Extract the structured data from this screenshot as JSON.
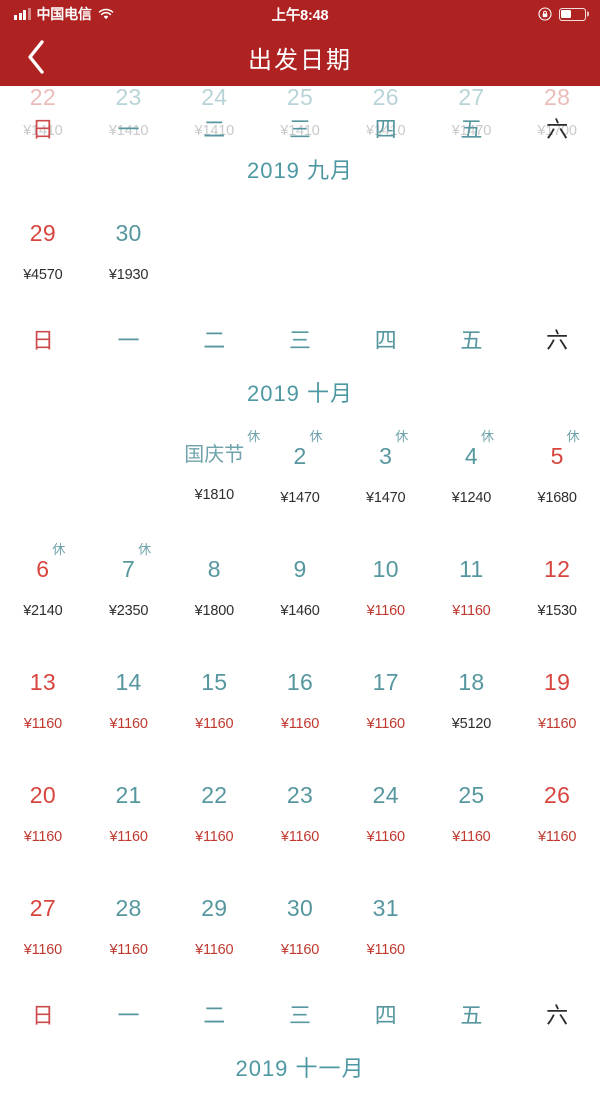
{
  "status_bar": {
    "carrier": "中国电信",
    "time": "上午8:48",
    "signal_icon": "signal-bars-icon",
    "wifi_icon": "wifi-icon",
    "rotation_lock_icon": "rotation-lock-icon",
    "battery_icon": "battery-icon",
    "battery_level_pct": 45,
    "background_color": "#AF2222"
  },
  "nav_bar": {
    "back_icon": "chevron-left-icon",
    "title": "出发日期",
    "background_color": "#AF2222"
  },
  "theme": {
    "accent_red": "#AF2222",
    "teal": "#56979F",
    "month_teal": "#4E98A3",
    "weekend_red": "#D8453E",
    "price_red": "#C0392F",
    "price_dark": "#2E2E2E",
    "faded_teal": "#B9D4D8",
    "faded_red": "#EBBCBA",
    "faded_gray": "#C9C9C9"
  },
  "weekday_header": {
    "labels": [
      "日",
      "一",
      "二",
      "三",
      "四",
      "五",
      "六"
    ],
    "sunday_color": "#CC4B4B",
    "saturday_color": "#2B2B2B",
    "weekday_color": "#56979F"
  },
  "currency_symbol": "¥",
  "rest_badge_label": "休",
  "months": [
    {
      "id": "september",
      "title": "2019  九月",
      "year": "2019",
      "month_label": "九月",
      "clipped_top_row": {
        "days": [
          {
            "num": "22",
            "price": "¥1410",
            "weekend": true
          },
          {
            "num": "23",
            "price": "¥1410",
            "weekend": false
          },
          {
            "num": "24",
            "price": "¥1410",
            "weekend": false
          },
          {
            "num": "25",
            "price": "¥1410",
            "weekend": false
          },
          {
            "num": "26",
            "price": "¥1410",
            "weekend": false
          },
          {
            "num": "27",
            "price": "¥1470",
            "weekend": false
          },
          {
            "num": "28",
            "price": "¥1700",
            "weekend": true
          }
        ]
      },
      "weeks": [
        [
          {
            "num": "29",
            "price": "¥4570",
            "weekend": true,
            "price_low": false,
            "rest": false
          },
          {
            "num": "30",
            "price": "¥1930",
            "weekend": false,
            "price_low": false,
            "rest": false
          },
          {
            "blank": true
          },
          {
            "blank": true
          },
          {
            "blank": true
          },
          {
            "blank": true
          },
          {
            "blank": true
          }
        ]
      ]
    },
    {
      "id": "october",
      "title": "2019  十月",
      "year": "2019",
      "month_label": "十月",
      "weeks": [
        [
          {
            "blank": true
          },
          {
            "blank": true
          },
          {
            "num": "国庆节",
            "festival": true,
            "price": "¥1810",
            "weekend": false,
            "price_low": false,
            "rest": true
          },
          {
            "num": "2",
            "price": "¥1470",
            "weekend": false,
            "price_low": false,
            "rest": true
          },
          {
            "num": "3",
            "price": "¥1470",
            "weekend": false,
            "price_low": false,
            "rest": true
          },
          {
            "num": "4",
            "price": "¥1240",
            "weekend": false,
            "price_low": false,
            "rest": true
          },
          {
            "num": "5",
            "price": "¥1680",
            "weekend": true,
            "price_low": false,
            "rest": true
          }
        ],
        [
          {
            "num": "6",
            "price": "¥2140",
            "weekend": true,
            "price_low": false,
            "rest": true
          },
          {
            "num": "7",
            "price": "¥2350",
            "weekend": false,
            "price_low": false,
            "rest": true
          },
          {
            "num": "8",
            "price": "¥1800",
            "weekend": false,
            "price_low": false,
            "rest": false
          },
          {
            "num": "9",
            "price": "¥1460",
            "weekend": false,
            "price_low": false,
            "rest": false
          },
          {
            "num": "10",
            "price": "¥1160",
            "weekend": false,
            "price_low": true,
            "rest": false
          },
          {
            "num": "11",
            "price": "¥1160",
            "weekend": false,
            "price_low": true,
            "rest": false
          },
          {
            "num": "12",
            "price": "¥1530",
            "weekend": true,
            "price_low": false,
            "rest": false
          }
        ],
        [
          {
            "num": "13",
            "price": "¥1160",
            "weekend": true,
            "price_low": true,
            "rest": false
          },
          {
            "num": "14",
            "price": "¥1160",
            "weekend": false,
            "price_low": true,
            "rest": false
          },
          {
            "num": "15",
            "price": "¥1160",
            "weekend": false,
            "price_low": true,
            "rest": false
          },
          {
            "num": "16",
            "price": "¥1160",
            "weekend": false,
            "price_low": true,
            "rest": false
          },
          {
            "num": "17",
            "price": "¥1160",
            "weekend": false,
            "price_low": true,
            "rest": false
          },
          {
            "num": "18",
            "price": "¥5120",
            "weekend": false,
            "price_low": false,
            "rest": false
          },
          {
            "num": "19",
            "price": "¥1160",
            "weekend": true,
            "price_low": true,
            "rest": false
          }
        ],
        [
          {
            "num": "20",
            "price": "¥1160",
            "weekend": true,
            "price_low": true,
            "rest": false
          },
          {
            "num": "21",
            "price": "¥1160",
            "weekend": false,
            "price_low": true,
            "rest": false
          },
          {
            "num": "22",
            "price": "¥1160",
            "weekend": false,
            "price_low": true,
            "rest": false
          },
          {
            "num": "23",
            "price": "¥1160",
            "weekend": false,
            "price_low": true,
            "rest": false
          },
          {
            "num": "24",
            "price": "¥1160",
            "weekend": false,
            "price_low": true,
            "rest": false
          },
          {
            "num": "25",
            "price": "¥1160",
            "weekend": false,
            "price_low": true,
            "rest": false
          },
          {
            "num": "26",
            "price": "¥1160",
            "weekend": true,
            "price_low": true,
            "rest": false
          }
        ],
        [
          {
            "num": "27",
            "price": "¥1160",
            "weekend": true,
            "price_low": true,
            "rest": false
          },
          {
            "num": "28",
            "price": "¥1160",
            "weekend": false,
            "price_low": true,
            "rest": false
          },
          {
            "num": "29",
            "price": "¥1160",
            "weekend": false,
            "price_low": true,
            "rest": false
          },
          {
            "num": "30",
            "price": "¥1160",
            "weekend": false,
            "price_low": true,
            "rest": false
          },
          {
            "num": "31",
            "price": "¥1160",
            "weekend": false,
            "price_low": true,
            "rest": false
          },
          {
            "blank": true
          },
          {
            "blank": true
          }
        ]
      ]
    },
    {
      "id": "november",
      "title": "2019  十一月",
      "year": "2019",
      "month_label": "十一月",
      "weeks": []
    }
  ]
}
